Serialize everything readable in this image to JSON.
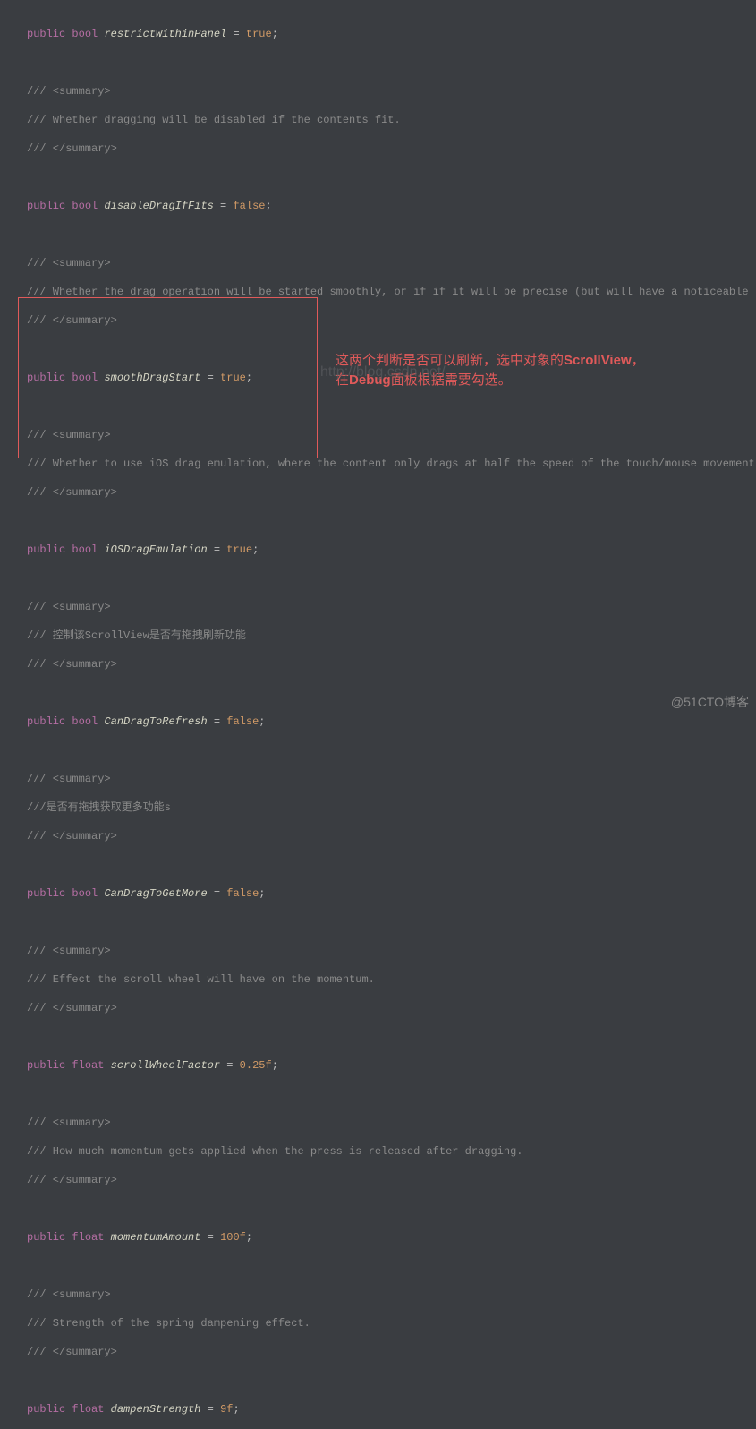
{
  "code": {
    "l1_kw1": "public",
    "l1_ty": "bool",
    "l1_id": "restrictWithinPanel",
    "l1_eq": " = ",
    "l1_val": "true",
    "l1_sc": ";",
    "c1_1": "/// <summary>",
    "c1_2": "/// Whether dragging will be disabled if the contents fit.",
    "c1_3": "/// </summary>",
    "l2_kw1": "public",
    "l2_ty": "bool",
    "l2_id": "disableDragIfFits",
    "l2_eq": " = ",
    "l2_val": "false",
    "l2_sc": ";",
    "c2_1": "/// <summary>",
    "c2_2": "/// Whether the drag operation will be started smoothly, or if if it will be precise (but will have a noticeable \"ju",
    "c2_3": "/// </summary>",
    "l3_kw1": "public",
    "l3_ty": "bool",
    "l3_id": "smoothDragStart",
    "l3_eq": " = ",
    "l3_val": "true",
    "l3_sc": ";",
    "c3_1": "/// <summary>",
    "c3_2": "/// Whether to use iOS drag emulation, where the content only drags at half the speed of the touch/mouse movement wh",
    "c3_3": "/// </summary>",
    "l4_kw1": "public",
    "l4_ty": "bool",
    "l4_id": "iOSDragEmulation",
    "l4_eq": " = ",
    "l4_val": "true",
    "l4_sc": ";",
    "c4_1": "/// <summary>",
    "c4_2": "/// 控制该ScrollView是否有拖拽刷新功能",
    "c4_3": "/// </summary>",
    "l5_kw1": "public",
    "l5_ty": "bool",
    "l5_id": "CanDragToRefresh",
    "l5_eq": " = ",
    "l5_val": "false",
    "l5_sc": ";",
    "c5_1": "/// <summary>",
    "c5_2": "///是否有拖拽获取更多功能s",
    "c5_3": "/// </summary>",
    "l6_kw1": "public",
    "l6_ty": "bool",
    "l6_id": "CanDragToGetMore",
    "l6_eq": " = ",
    "l6_val": "false",
    "l6_sc": ";",
    "c6_1": "/// <summary>",
    "c6_2": "/// Effect the scroll wheel will have on the momentum.",
    "c6_3": "/// </summary>",
    "l7_kw1": "public",
    "l7_ty": "float",
    "l7_id": "scrollWheelFactor",
    "l7_eq": " = ",
    "l7_val": "0.25f",
    "l7_sc": ";",
    "c7_1": "/// <summary>",
    "c7_2": "/// How much momentum gets applied when the press is released after dragging.",
    "c7_3": "/// </summary>",
    "l8_kw1": "public",
    "l8_ty": "float",
    "l8_id": "momentumAmount",
    "l8_eq": " = ",
    "l8_val": "100f",
    "l8_sc": ";",
    "c8_1": "/// <summary>",
    "c8_2": "/// Strength of the spring dampening effect.",
    "c8_3": "/// </summary>",
    "l9_kw1": "public",
    "l9_ty": "float",
    "l9_id": "dampenStrength",
    "l9_eq": " = ",
    "l9_val": "9f",
    "l9_sc": ";"
  },
  "annotation": {
    "line1_a": "这两个判断是否可以刷新，选中对象的",
    "line1_b": "ScrollView",
    "line1_c": "，",
    "line2_a": "在",
    "line2_b": "Debug",
    "line2_c": "面板根据需要勾选。"
  },
  "watermark": "http://blog.csdn.net/",
  "source": "@51CTO博客"
}
